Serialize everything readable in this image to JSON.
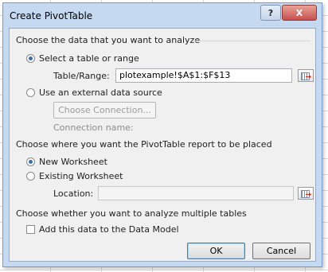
{
  "dialog": {
    "title": "Create PivotTable",
    "help_label": "?",
    "close_label": "X"
  },
  "section_data": {
    "heading": "Choose the data that you want to analyze",
    "select_table_label": "Select a table or range",
    "table_range_label": "Table/Range:",
    "table_range_value": "plotexample!$A$1:$F$13",
    "external_label": "Use an external data source",
    "choose_connection_label": "Choose Connection...",
    "connection_name_label": "Connection name:"
  },
  "section_place": {
    "heading": "Choose where you want the PivotTable report to be placed",
    "new_ws_label": "New Worksheet",
    "existing_ws_label": "Existing Worksheet",
    "location_label": "Location:",
    "location_value": ""
  },
  "section_multi": {
    "heading": "Choose whether you want to analyze multiple tables",
    "add_model_label": "Add this data to the Data Model"
  },
  "buttons": {
    "ok_label": "OK",
    "cancel_label": "Cancel"
  },
  "state": {
    "data_source": "select_table",
    "placement": "new_worksheet",
    "add_to_data_model": false
  },
  "colors": {
    "dialog_frame": "#c5d9f1",
    "client_bg": "#f0f0f0",
    "radio_dot": "#3a6ea5",
    "close_button": "#c75050"
  },
  "icons": {
    "help": "question-mark-icon",
    "close": "close-icon",
    "refedit": "range-selector-icon"
  }
}
